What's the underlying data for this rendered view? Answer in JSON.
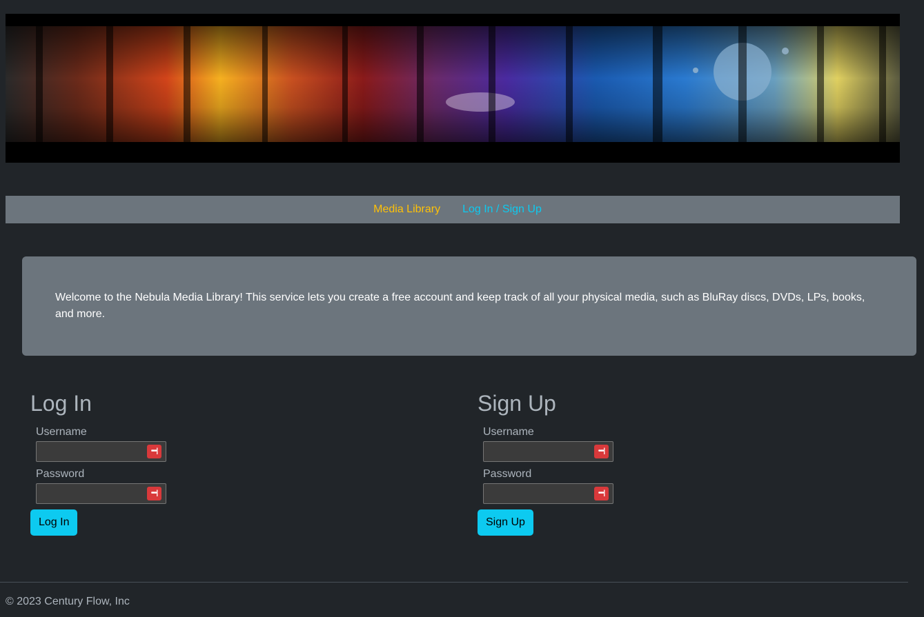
{
  "nav": {
    "media_library": "Media Library",
    "login_signup": "Log In / Sign Up"
  },
  "welcome": {
    "text": "Welcome to the Nebula Media Library! This service lets you create a free account and keep track of all your physical media, such as BluRay discs, DVDs, LPs, books, and more."
  },
  "login": {
    "title": "Log In",
    "username_label": "Username",
    "password_label": "Password",
    "button": "Log In"
  },
  "signup": {
    "title": "Sign Up",
    "username_label": "Username",
    "password_label": "Password",
    "button": "Sign Up"
  },
  "password_manager_icon": "password-manager-icon",
  "footer": {
    "copyright": "© 2023 Century Flow, Inc"
  },
  "colors": {
    "page_bg": "#212529",
    "panel_bg": "#6c757d",
    "accent_warning": "#ffc107",
    "accent_info": "#0dcaf0"
  }
}
